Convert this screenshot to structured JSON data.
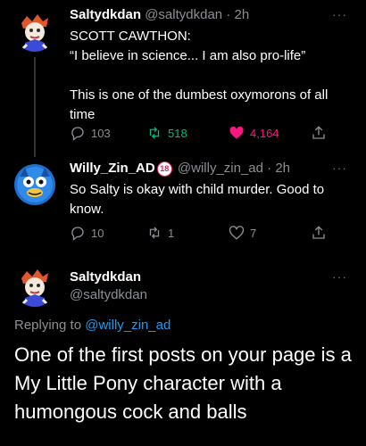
{
  "tweet1": {
    "name": "Saltydkdan",
    "handle": "@saltydkdan",
    "sep": "·",
    "time": "2h",
    "lines": [
      "SCOTT CAWTHON:",
      "“I believe in science... I am also pro-life”",
      "",
      "This is one of the dumbest oxymorons of all",
      "time"
    ],
    "replies": "103",
    "retweets": "518",
    "likes": "4,164"
  },
  "tweet2": {
    "name": "Willy_Zin_AD",
    "badge": "18",
    "handle": "@willy_zin_ad",
    "sep": "·",
    "time": "2h",
    "lines": [
      "So Salty is okay with child murder. Good to",
      "know."
    ],
    "replies": "10",
    "retweets": "1",
    "likes": "7"
  },
  "tweet3": {
    "name": "Saltydkdan",
    "handle": "@saltydkdan",
    "replying_prefix": "Replying to",
    "replying_to": "@willy_zin_ad",
    "lines": [
      "One of the first posts on your page is a",
      "My Little Pony character with a",
      "humongous cock and balls"
    ]
  },
  "more_glyph": "···",
  "colors": {
    "background": "#000000",
    "retweet_active": "#00ba7c",
    "like_active": "#f91880",
    "mention": "#1d9bf0",
    "muted": "#8b8f94"
  }
}
